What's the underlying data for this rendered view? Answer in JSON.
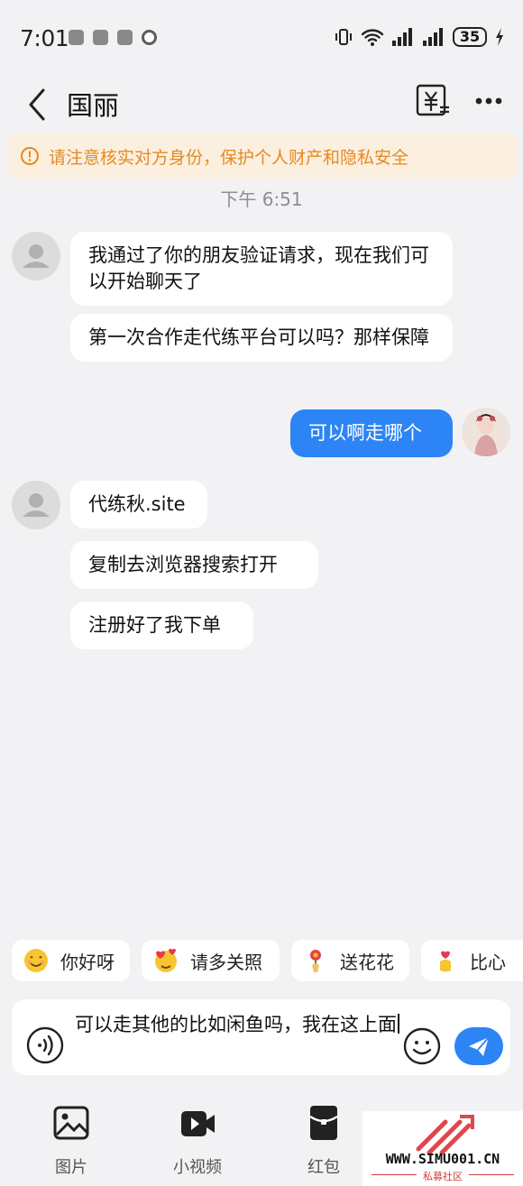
{
  "status_bar": {
    "time": "7:01",
    "battery": "35"
  },
  "header": {
    "title": "国丽"
  },
  "banner": {
    "text": "请注意核实对方身份，保护个人财产和隐私安全"
  },
  "timestamp": "下午 6:51",
  "messages": [
    {
      "sender": "other",
      "text": "我通过了你的朋友验证请求，现在我们可以开始聊天了"
    },
    {
      "sender": "other",
      "text": "第一次合作走代练平台可以吗？那样保障"
    },
    {
      "sender": "me",
      "text": "可以啊走哪个"
    },
    {
      "sender": "other",
      "text": "代练秋.site"
    },
    {
      "sender": "other",
      "text": "复制去浏览器搜索打开"
    },
    {
      "sender": "other",
      "text": "注册好了我下单"
    }
  ],
  "quick_replies": [
    {
      "label": "你好呀",
      "icon": "smile-emoji-icon"
    },
    {
      "label": "请多关照",
      "icon": "hearts-emoji-icon"
    },
    {
      "label": "送花花",
      "icon": "flower-emoji-icon"
    },
    {
      "label": "比心",
      "icon": "finger-heart-emoji-icon"
    }
  ],
  "input": {
    "value": "可以走其他的比如闲鱼吗，我在这上面"
  },
  "toolbar": [
    {
      "label": "图片",
      "icon": "image-icon"
    },
    {
      "label": "小视频",
      "icon": "video-icon"
    },
    {
      "label": "红包",
      "icon": "red-packet-icon"
    }
  ],
  "watermark": {
    "site": "WWW.SIMU001.CN",
    "sub": "私募社区"
  },
  "colors": {
    "accent": "#2d84f5",
    "banner_bg": "#fbefdf",
    "banner_text": "#e58a23",
    "background": "#f2f2f4"
  }
}
